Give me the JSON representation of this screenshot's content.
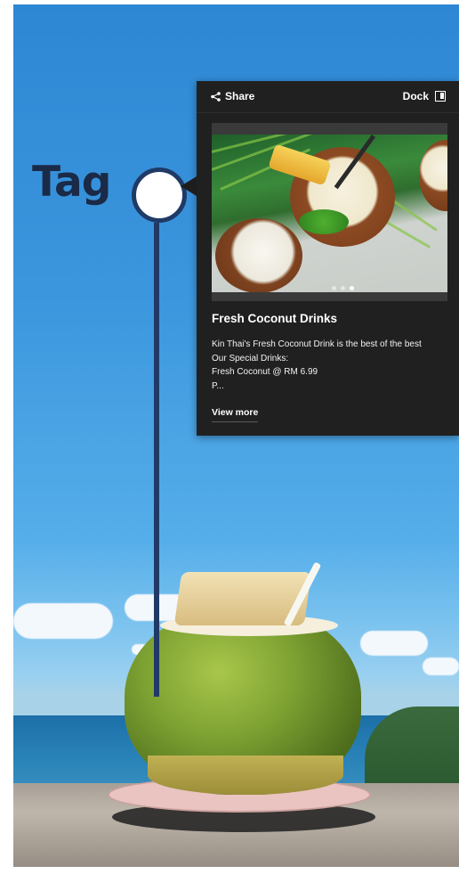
{
  "tag": {
    "label": "Tag"
  },
  "panel": {
    "share_label": "Share",
    "dock_label": "Dock",
    "carousel": {
      "slide_count": 3,
      "active_index": 2
    },
    "title": "Fresh Coconut Drinks",
    "description_lines": [
      "Kin Thai's Fresh Coconut Drink is the best of the best",
      "Our Special Drinks:",
      "Fresh Coconut @ RM 6.99",
      "P..."
    ],
    "view_more_label": "View more"
  },
  "icons": {
    "share": "share-icon",
    "dock": "dock-icon"
  },
  "colors": {
    "panel_bg": "#202020",
    "tag_navy": "#1f3a66",
    "tag_text": "#1a2a47",
    "sky": "#3d97de"
  }
}
